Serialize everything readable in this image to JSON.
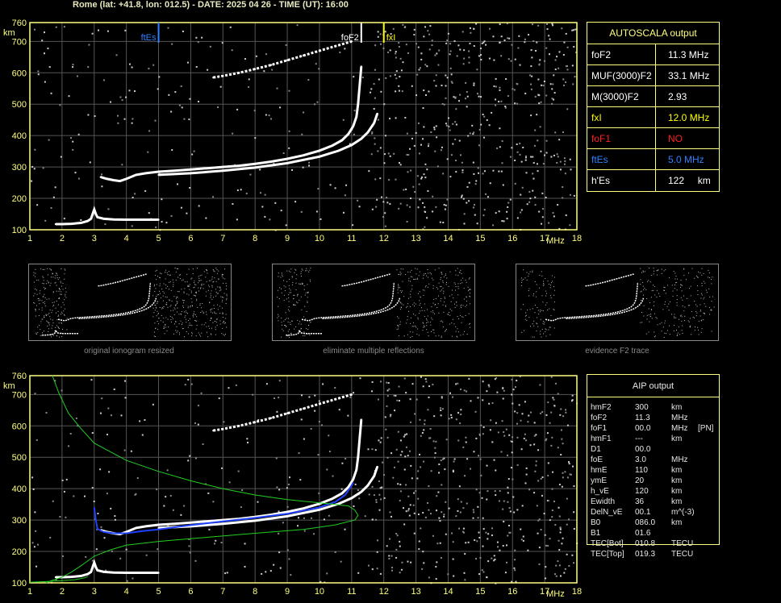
{
  "header": {
    "title": "Rome (lat: +41.8, lon: 012.5) - DATE: 2025 04 26 - TIME (UT): 16:00"
  },
  "colors": {
    "axis": "#ffff80",
    "grid": "#555555",
    "foF2": "#ffffff",
    "fxI": "#ffff00",
    "foF1": "#ff2020",
    "ftEs": "#3080ff",
    "profile_green": "#20d020",
    "trace_blue": "#2040ff"
  },
  "chart_data": [
    {
      "type": "scatter",
      "title": "",
      "xlabel": "MHz",
      "ylabel": "km",
      "xlim": [
        1,
        18
      ],
      "ylim": [
        100,
        760
      ],
      "x_ticks": [
        "1",
        "2",
        "3",
        "4",
        "5",
        "6",
        "7",
        "8",
        "9",
        "10",
        "11",
        "12",
        "13",
        "14",
        "15",
        "16",
        "17",
        "18"
      ],
      "y_ticks": [
        "100",
        "200",
        "300",
        "400",
        "500",
        "600",
        "700",
        "760"
      ],
      "grid": true,
      "markers": [
        {
          "label": "ftEs",
          "x": 5.0
        },
        {
          "label": "foF2",
          "x": 11.3
        },
        {
          "label": "fxI",
          "x": 12.0
        }
      ],
      "series": [
        {
          "x": [
            1.8,
            2.0,
            2.3,
            2.6,
            2.8,
            2.9,
            2.95,
            3.0,
            3.05,
            3.1,
            3.3,
            3.6,
            4.0,
            4.5,
            5.0
          ],
          "y": [
            118,
            118,
            119,
            122,
            128,
            135,
            150,
            165,
            150,
            140,
            135,
            133,
            132,
            132,
            132
          ]
        },
        {
          "x": [
            3.2,
            3.4,
            3.6,
            3.8,
            4.0,
            4.3,
            4.6,
            5.0,
            5.5,
            6.0,
            6.5,
            7.0,
            7.5,
            8.0,
            8.5,
            9.0,
            9.5,
            10.0,
            10.4,
            10.7,
            10.9,
            11.05,
            11.15,
            11.2,
            11.25,
            11.3
          ],
          "y": [
            268,
            262,
            258,
            255,
            262,
            275,
            280,
            285,
            288,
            292,
            296,
            300,
            304,
            310,
            317,
            326,
            337,
            352,
            368,
            385,
            405,
            430,
            460,
            500,
            560,
            620
          ]
        },
        {
          "x": [
            5.0,
            6.0,
            7.0,
            8.0,
            9.0,
            10.0,
            10.6,
            11.0,
            11.3,
            11.5,
            11.7,
            11.8
          ],
          "y": [
            275,
            280,
            288,
            298,
            312,
            333,
            352,
            370,
            390,
            410,
            440,
            470
          ]
        },
        {
          "x": [
            6.7,
            7.0,
            7.5,
            8.0,
            8.5,
            9.0,
            9.5,
            10.0,
            10.5,
            11.0
          ],
          "y": [
            585,
            590,
            600,
            612,
            625,
            640,
            655,
            670,
            685,
            700
          ]
        }
      ]
    },
    {
      "type": "scatter",
      "title": "",
      "xlabel": "MHz",
      "ylabel": "km",
      "xlim": [
        1,
        18
      ],
      "ylim": [
        100,
        760
      ],
      "x_ticks": [
        "1",
        "2",
        "3",
        "4",
        "5",
        "6",
        "7",
        "8",
        "9",
        "10",
        "11",
        "12",
        "13",
        "14",
        "15",
        "16",
        "17",
        "18"
      ],
      "y_ticks": [
        "100",
        "200",
        "300",
        "400",
        "500",
        "600",
        "700",
        "760"
      ],
      "grid": true,
      "series": [
        {
          "x": [
            1.8,
            2.0,
            2.3,
            2.6,
            2.8,
            2.9,
            2.95,
            3.0,
            3.05,
            3.1,
            3.3,
            3.6,
            4.0,
            4.5,
            5.0
          ],
          "y": [
            118,
            118,
            119,
            122,
            128,
            135,
            150,
            165,
            150,
            140,
            135,
            133,
            132,
            132,
            132
          ]
        },
        {
          "x": [
            3.2,
            3.4,
            3.6,
            3.8,
            4.0,
            4.3,
            4.6,
            5.0,
            5.5,
            6.0,
            6.5,
            7.0,
            7.5,
            8.0,
            8.5,
            9.0,
            9.5,
            10.0,
            10.4,
            10.7,
            10.9,
            11.05,
            11.15,
            11.2,
            11.25,
            11.3
          ],
          "y": [
            268,
            262,
            258,
            255,
            262,
            275,
            280,
            285,
            288,
            292,
            296,
            300,
            304,
            310,
            317,
            326,
            337,
            352,
            368,
            385,
            405,
            430,
            460,
            500,
            560,
            620
          ]
        },
        {
          "x": [
            5.0,
            6.0,
            7.0,
            8.0,
            9.0,
            10.0,
            10.6,
            11.0,
            11.3,
            11.5,
            11.7,
            11.8
          ],
          "y": [
            275,
            280,
            288,
            298,
            312,
            333,
            352,
            370,
            390,
            410,
            440,
            470
          ]
        },
        {
          "x": [
            6.7,
            7.0,
            7.5,
            8.0,
            8.5,
            9.0,
            9.5,
            10.0,
            10.5,
            11.0
          ],
          "y": [
            585,
            590,
            600,
            612,
            625,
            640,
            655,
            670,
            685,
            700
          ]
        },
        {
          "x": [
            3.0,
            3.05,
            3.1,
            3.3,
            3.6,
            4.0,
            4.5,
            5.0,
            6.0,
            7.0,
            8.0,
            9.0,
            10.0,
            10.5,
            10.8,
            11.0,
            11.05
          ],
          "y": [
            340,
            300,
            272,
            262,
            258,
            258,
            265,
            270,
            284,
            296,
            307,
            320,
            340,
            358,
            380,
            410,
            420
          ]
        },
        {
          "x": [
            1.0,
            1.5,
            2.0,
            2.4,
            2.7,
            2.8
          ],
          "y": [
            102,
            104,
            107,
            110,
            116,
            120
          ]
        },
        {
          "x": [
            1.7,
            1.9,
            2.2,
            2.6,
            3.0,
            4.0,
            5.0,
            6.0,
            7.0,
            8.0,
            9.0,
            9.5,
            10.0,
            10.5,
            10.9,
            11.1,
            11.2,
            11.1,
            10.5,
            9.5,
            8.0,
            6.5,
            5.0,
            4.0,
            3.5,
            3.0,
            2.6,
            2.3,
            2.0,
            1.7,
            1.5
          ],
          "y": [
            760,
            705,
            640,
            590,
            545,
            490,
            455,
            425,
            400,
            380,
            365,
            360,
            355,
            350,
            345,
            332,
            315,
            300,
            285,
            270,
            258,
            245,
            232,
            220,
            205,
            185,
            155,
            135,
            118,
            108,
            100
          ]
        }
      ]
    }
  ],
  "autoscala": {
    "header": "AUTOSCALA output",
    "rows": [
      {
        "label": "foF2",
        "value": "11.3 MHz",
        "color": "#ffffff"
      },
      {
        "label": "MUF(3000)F2",
        "value": "33.1 MHz",
        "color": "#ffffff"
      },
      {
        "label": "M(3000)F2",
        "value": "2.93",
        "color": "#ffffff"
      },
      {
        "label": "fxI",
        "value": "12.0 MHz",
        "color": "#ffff00"
      },
      {
        "label": "foF1",
        "value": "NO",
        "color": "#ff2020"
      },
      {
        "label": "ftEs",
        "value": "5.0 MHz",
        "color": "#3080ff"
      },
      {
        "label": "h'Es",
        "value": "122     km",
        "color": "#ffffff"
      }
    ]
  },
  "thumbnails": [
    {
      "caption": "original ionogram resized"
    },
    {
      "caption": "eliminate multiple reflections"
    },
    {
      "caption": "evidence F2 trace"
    }
  ],
  "aip": {
    "header": "AIP output",
    "rows": [
      {
        "name": "hmF2",
        "value": "300",
        "unit": "km",
        "extra": ""
      },
      {
        "name": "foF2",
        "value": "11.3",
        "unit": "MHz",
        "extra": ""
      },
      {
        "name": "foF1",
        "value": "00.0",
        "unit": "MHz",
        "extra": "[PN]"
      },
      {
        "name": "hmF1",
        "value": "---",
        "unit": "km",
        "extra": ""
      },
      {
        "name": "D1",
        "value": "00.0",
        "unit": "",
        "extra": ""
      },
      {
        "name": "foE",
        "value": "3.0",
        "unit": "MHz",
        "extra": ""
      },
      {
        "name": "hmE",
        "value": "110",
        "unit": "km",
        "extra": ""
      },
      {
        "name": "ymE",
        "value": "20",
        "unit": "km",
        "extra": ""
      },
      {
        "name": "h_vE",
        "value": "120",
        "unit": "km",
        "extra": ""
      },
      {
        "name": "Ewidth",
        "value": "36",
        "unit": "km",
        "extra": ""
      },
      {
        "name": "DelN_vE",
        "value": "00.1",
        "unit": "m^(-3)",
        "extra": ""
      },
      {
        "name": "B0",
        "value": "086.0",
        "unit": "km",
        "extra": ""
      },
      {
        "name": "B1",
        "value": "01.6",
        "unit": "",
        "extra": ""
      },
      {
        "name": "TEC[Bot]",
        "value": "010.8",
        "unit": "TECU",
        "extra": ""
      },
      {
        "name": "TEC[Top]",
        "value": "019.3",
        "unit": "TECU",
        "extra": ""
      }
    ]
  }
}
